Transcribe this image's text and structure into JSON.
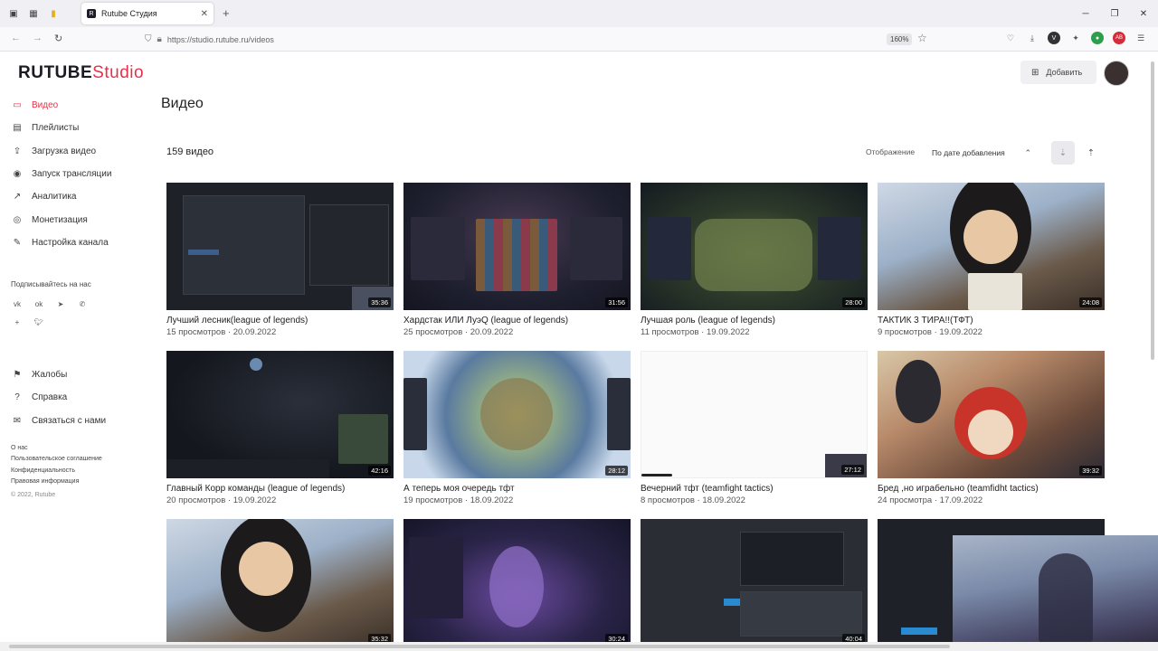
{
  "browser": {
    "tab_title": "Rutube Студия",
    "url": "https://studio.rutube.ru/videos",
    "zoom": "160%"
  },
  "brand": {
    "logo_main": "RUTUBE",
    "logo_studio": "Studio",
    "accent": "#e3334a"
  },
  "sidebar": {
    "items": [
      {
        "label": "Видео",
        "icon": "video-icon",
        "active": true
      },
      {
        "label": "Плейлисты",
        "icon": "playlist-icon"
      },
      {
        "label": "Загрузка видео",
        "icon": "upload-icon"
      },
      {
        "label": "Запуск трансляции",
        "icon": "broadcast-icon"
      },
      {
        "label": "Аналитика",
        "icon": "analytics-icon"
      },
      {
        "label": "Монетизация",
        "icon": "monetization-icon"
      },
      {
        "label": "Настройка канала",
        "icon": "settings-icon"
      }
    ],
    "subscribe_label": "Подписывайтесь на нас",
    "secondary": [
      {
        "label": "Жалобы",
        "icon": "flag-icon"
      },
      {
        "label": "Справка",
        "icon": "help-icon"
      },
      {
        "label": "Связаться с нами",
        "icon": "mail-icon"
      }
    ],
    "footer": {
      "about": "О нас",
      "agreement": "Пользовательское соглашение",
      "privacy": "Конфиденциальность",
      "legal": "Правовая информация",
      "copyright": "© 2022, Rutube"
    }
  },
  "header": {
    "add_label": "Добавить"
  },
  "main": {
    "title": "Видео",
    "count": "159 видео",
    "display_label": "Отображение",
    "sort_value": "По дате добавления"
  },
  "videos": [
    {
      "title": "Лучший лесник(league of legends)",
      "views": "15 просмотров",
      "date": "20.09.2022",
      "duration": "35:36"
    },
    {
      "title": "Хардстак ИЛИ ЛуэQ (league of legends)",
      "views": "25 просмотров",
      "date": "20.09.2022",
      "duration": "31:56"
    },
    {
      "title": "Лучшая роль (league of legends)",
      "views": "11 просмотров",
      "date": "19.09.2022",
      "duration": "28:00"
    },
    {
      "title": "ТАКТИК 3 ТИРА!!(ТФТ)",
      "views": "9 просмотров",
      "date": "19.09.2022",
      "duration": "24:08"
    },
    {
      "title": "Главный Корр команды (league of legends)",
      "views": "20 просмотров",
      "date": "19.09.2022",
      "duration": "42:16"
    },
    {
      "title": "А теперь моя очередь тфт",
      "views": "19 просмотров",
      "date": "18.09.2022",
      "duration": "28:12"
    },
    {
      "title": "Вечерний тфт (teamfight tactics)",
      "views": "8 просмотров",
      "date": "18.09.2022",
      "duration": "27:12"
    },
    {
      "title": "Бред ,но играбельно (teamfidht tactics)",
      "views": "24 просмотра",
      "date": "17.09.2022",
      "duration": "39:32"
    },
    {
      "title": "",
      "views": "",
      "date": "",
      "duration": "35:32"
    },
    {
      "title": "",
      "views": "",
      "date": "",
      "duration": "30:24"
    },
    {
      "title": "",
      "views": "",
      "date": "",
      "duration": "40:04"
    },
    {
      "title": "",
      "views": "",
      "date": "",
      "duration": ""
    }
  ]
}
